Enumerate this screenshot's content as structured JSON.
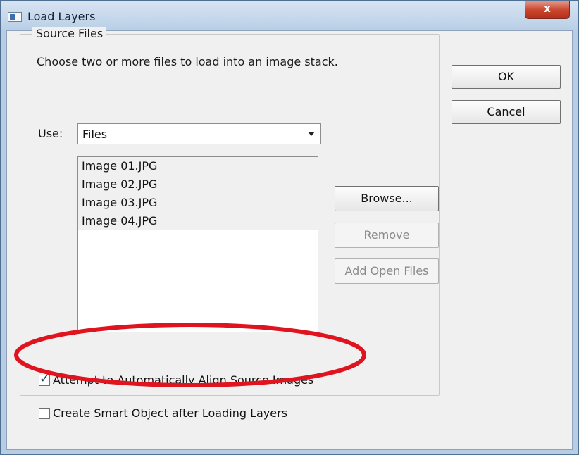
{
  "window": {
    "title": "Load Layers",
    "close_label": "x"
  },
  "source_files": {
    "group_label": "Source Files",
    "description": "Choose two or more files to load into an image stack."
  },
  "use": {
    "label": "Use:",
    "selected": "Files"
  },
  "files": [
    "Image 01.JPG",
    "Image 02.JPG",
    "Image 03.JPG",
    "Image 04.JPG"
  ],
  "buttons": {
    "ok": "OK",
    "cancel": "Cancel",
    "browse": "Browse...",
    "remove": "Remove",
    "add_open_files": "Add Open Files"
  },
  "options": {
    "align_label": "Attempt to Automatically Align Source Images",
    "align_checked": true,
    "smart_object_label": "Create Smart Object after Loading Layers",
    "smart_object_checked": false
  },
  "colors": {
    "highlight": "#e0141e"
  }
}
